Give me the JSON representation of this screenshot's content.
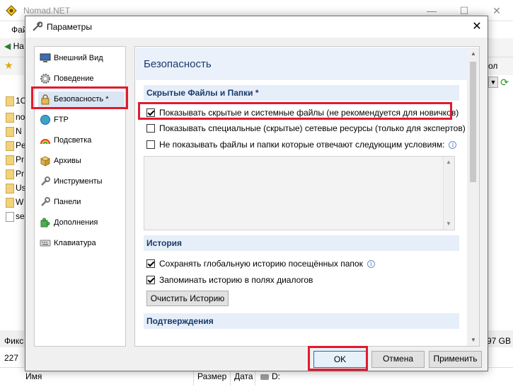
{
  "background": {
    "app_title": "Nomad.NET",
    "menu_file": "Фай",
    "nav_label": "На",
    "right_label": "ол",
    "files": [
      "1С",
      "no",
      "N",
      "Pe",
      "Pr",
      "Pr",
      "Us",
      "W",
      "se"
    ],
    "status_left": "Фикс",
    "status_right": "97 GB",
    "count": "227",
    "columns": {
      "name": "Имя",
      "size": "Размер",
      "date": "Дата",
      "drive": "D:"
    },
    "window_buttons": {
      "minimize": "—",
      "maximize": "☐",
      "close": "✕"
    }
  },
  "dialog": {
    "title": "Параметры",
    "close_glyph": "✕",
    "nav_items": [
      {
        "label": "Внешний Вид",
        "icon": "monitor-icon"
      },
      {
        "label": "Поведение",
        "icon": "gear-icon"
      },
      {
        "label": "Безопасность *",
        "icon": "lock-icon"
      },
      {
        "label": "FTP",
        "icon": "globe-icon"
      },
      {
        "label": "Подсветка",
        "icon": "rainbow-icon"
      },
      {
        "label": "Архивы",
        "icon": "archive-box-icon"
      },
      {
        "label": "Инструменты",
        "icon": "wrench-icon"
      },
      {
        "label": "Панели",
        "icon": "panels-icon"
      },
      {
        "label": "Дополнения",
        "icon": "puzzle-icon"
      },
      {
        "label": "Клавиатура",
        "icon": "keyboard-icon"
      }
    ],
    "content": {
      "title": "Безопасность",
      "section_hidden": "Скрытые Файлы и Папки *",
      "chk_show_hidden": "Показывать скрытые и системные файлы (не рекомендуется для новичков)",
      "chk_show_special": "Показывать специальные (скрытые) сетевые ресурсы (только для экспертов)",
      "chk_hide_matching": "Не показывать файлы и папки которые отвечают следующим условиям:",
      "section_history": "История",
      "chk_global_history": "Сохранять глобальную историю посещённых папок",
      "chk_dialog_history": "Запоминать историю в полях диалогов",
      "clear_history_btn": "Очистить Историю",
      "section_confirm": "Подтверждения",
      "checked": {
        "show_hidden": true,
        "show_special": false,
        "hide_matching": false,
        "global_history": true,
        "dialog_history": true
      }
    },
    "buttons": {
      "ok": "OK",
      "cancel": "Отмена",
      "apply": "Применить"
    }
  },
  "colors": {
    "highlight": "#e01b2f",
    "accent": "#0078d7",
    "section_bg": "#e6eef9"
  }
}
